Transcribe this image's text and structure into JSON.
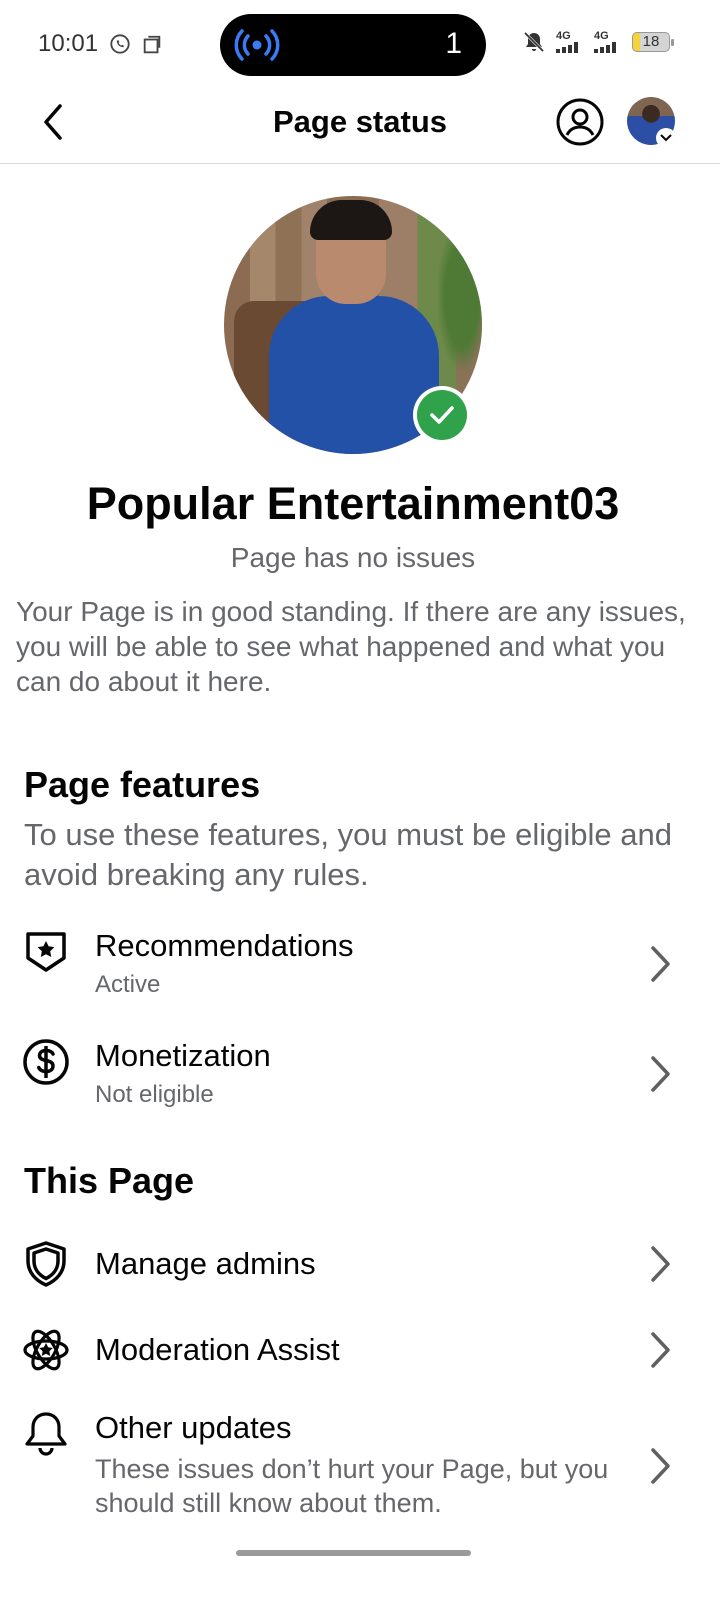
{
  "status_bar": {
    "time": "10:01",
    "island_count": "1",
    "network_1": "4G",
    "network_2": "4G",
    "battery": "18"
  },
  "header": {
    "title": "Page status"
  },
  "profile": {
    "name": "Popular Entertainment03",
    "status": "Page has no issues",
    "description": "Your Page is in good standing. If there are any issues, you will be able to see what happened and what you can do about it here."
  },
  "features": {
    "title": "Page features",
    "subtitle": "To use these features, you must be eligible and avoid breaking any rules.",
    "items": [
      {
        "label": "Recommendations",
        "status": "Active",
        "icon": "shield-star-icon"
      },
      {
        "label": "Monetization",
        "status": "Not eligible",
        "icon": "dollar-circle-icon"
      }
    ]
  },
  "this_page": {
    "title": "This Page",
    "items": [
      {
        "label": "Manage admins",
        "icon": "shield-icon"
      },
      {
        "label": "Moderation Assist",
        "icon": "atom-star-icon"
      },
      {
        "label": "Other updates",
        "sub": "These issues don’t hurt your Page, but you should still know about them.",
        "icon": "bell-icon"
      }
    ]
  },
  "colors": {
    "verified": "#31a24c",
    "secondary_text": "#65676b",
    "primary_text": "#050505"
  }
}
